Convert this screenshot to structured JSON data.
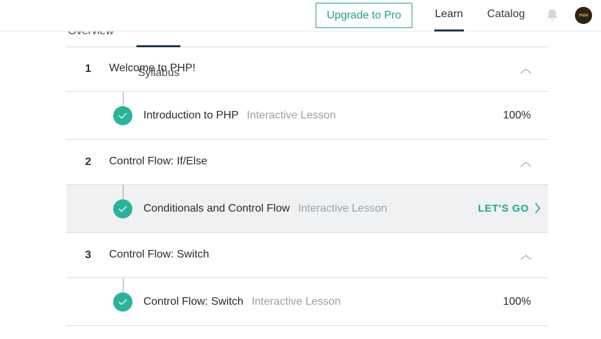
{
  "header": {
    "upgrade_label": "Upgrade to Pro",
    "nav": {
      "learn": "Learn",
      "catalog": "Catalog"
    },
    "avatar_text": "HNSN"
  },
  "subtabs": {
    "overview": "Overview",
    "syllabus": "Syllabus"
  },
  "modules": [
    {
      "number": "1",
      "title": "Welcome to PHP!",
      "lesson": {
        "title": "Introduction to PHP",
        "type": "Interactive Lesson",
        "progress": "100%"
      }
    },
    {
      "number": "2",
      "title": "Control Flow: If/Else",
      "lesson": {
        "title": "Conditionals and Control Flow",
        "type": "Interactive Lesson",
        "action": "LET'S GO"
      }
    },
    {
      "number": "3",
      "title": "Control Flow: Switch",
      "lesson": {
        "title": "Control Flow: Switch",
        "type": "Interactive Lesson",
        "progress": "100%"
      }
    }
  ],
  "colors": {
    "accent": "#1e9e8c",
    "check": "#2ab39b",
    "nav_active": "#1e3a4a"
  }
}
